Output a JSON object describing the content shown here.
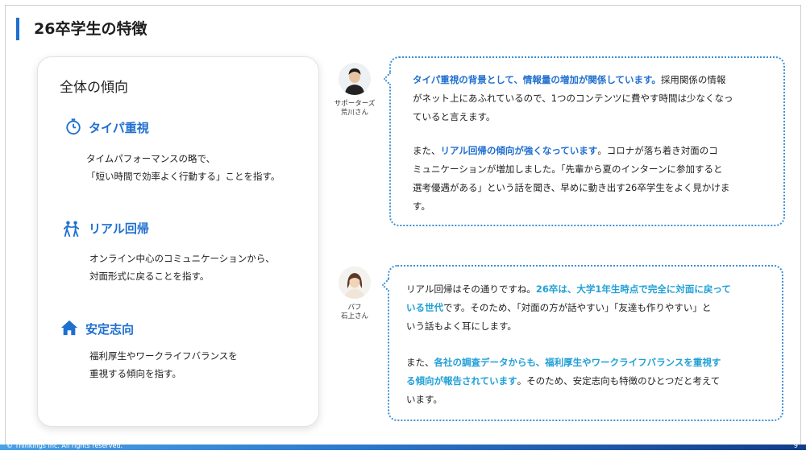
{
  "slide": {
    "title": "26卒学生の特徴",
    "page_number": "9",
    "copyright": "© Thinkings Inc. All rights reserved."
  },
  "left_panel": {
    "heading": "全体の傾向",
    "items": [
      {
        "icon": "stopwatch-icon",
        "title": "タイパ重視",
        "desc_line1": "タイムパフォーマンスの略で、",
        "desc_line2": "「短い時間で効率よく行動する」ことを指す。"
      },
      {
        "icon": "people-icon",
        "title": "リアル回帰",
        "desc_line1": "オンライン中心のコミュニケーションから、",
        "desc_line2": "対面形式に戻ることを指す。"
      },
      {
        "icon": "home-icon",
        "title": "安定志向",
        "desc_line1": "福利厚生やワークライフバランスを",
        "desc_line2": "重視する傾向を指す。"
      }
    ]
  },
  "speakers": [
    {
      "role": "サポーターズ",
      "name": "荒川さん",
      "icon": "man-avatar-icon"
    },
    {
      "role": "パフ",
      "name": "石上さん",
      "icon": "woman-avatar-icon"
    }
  ],
  "bubble1": {
    "p1_hl": "タイパ重視の背景として、情報量の増加が関係しています。",
    "p1_l1_rest": "採用関係の情報",
    "p1_l2": "がネット上にあふれているので、1つのコンテンツに費やす時間は少なくなっ",
    "p1_l3": "ていると言えます。",
    "p2_pre": "また、",
    "p2_hl": "リアル回帰の傾向が強くなっています",
    "p2_l1_rest": "。コロナが落ち着き対面のコ",
    "p2_l2": "ミュニケーションが増加しました。「先輩から夏のインターンに参加すると",
    "p2_l3": "選考優遇がある」という話を聞き、早めに動き出す26卒学生をよく見かけま",
    "p2_l4": "す。"
  },
  "bubble2": {
    "p1_pre": "リアル回帰はその通りですね。",
    "p1_hl_a": "26卒は、大学1年生時点で完全に対面に戻って",
    "p1_hl_b": "いる世代",
    "p1_l2_rest": "です。そのため、「対面の方が話やすい」「友達も作りやすい」と",
    "p1_l3": "いう話もよく耳にします。",
    "p2_pre": "また、",
    "p2_hl_a": "各社の調査データからも、福利厚生やワークライフバランスを重視す",
    "p2_hl_b": "る傾向が報告されています",
    "p2_l2_rest": "。そのため、安定志向も特徴のひとつだと考えて",
    "p2_l3": "います。"
  },
  "colors": {
    "accent_blue": "#1f6fd0",
    "highlight_cyan": "#21a0d6",
    "bubble_border": "#3a8fd6"
  }
}
